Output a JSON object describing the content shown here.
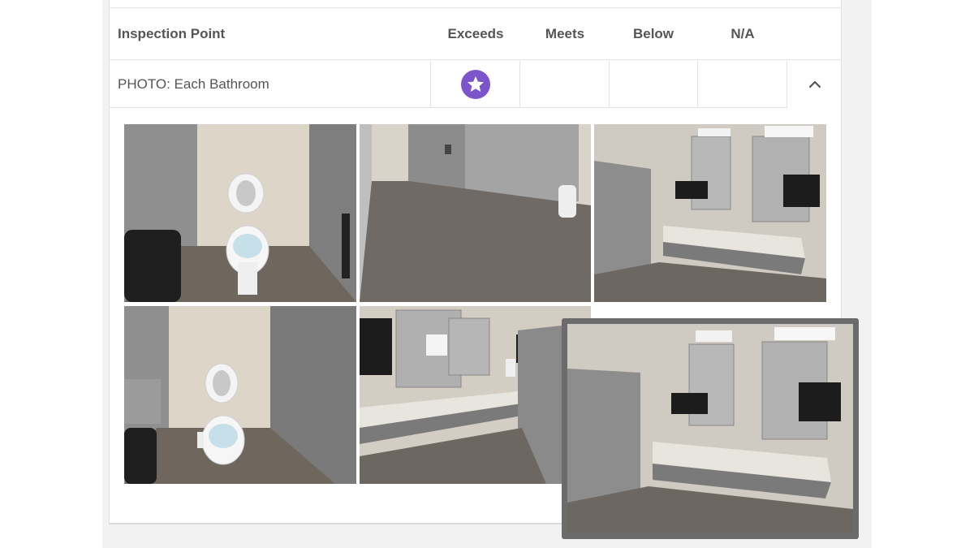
{
  "table": {
    "headers": {
      "inspection_point": "Inspection Point",
      "exceeds": "Exceeds",
      "meets": "Meets",
      "below": "Below",
      "na": "N/A"
    },
    "rows": [
      {
        "inspection_point": "PHOTO: Each Bathroom",
        "rating": "exceeds",
        "rating_icon": "star-icon",
        "expand_icon": "chevron-up-icon"
      }
    ]
  },
  "photos": [
    {
      "subject": "toilet-stall-photo"
    },
    {
      "subject": "restroom-floor-partitions-photo"
    },
    {
      "subject": "sink-vanity-mirrors-photo"
    },
    {
      "subject": "toilet-stall-photo-2"
    },
    {
      "subject": "sinks-paper-towel-photo"
    }
  ],
  "enlarged_photo": {
    "subject": "sink-vanity-mirrors-photo-enlarged"
  },
  "colors": {
    "accent_purple": "#7b55c9",
    "page_bg": "#f2f2f2",
    "border": "#e3e3e3",
    "overlay_frame": "#6b6b6b"
  }
}
